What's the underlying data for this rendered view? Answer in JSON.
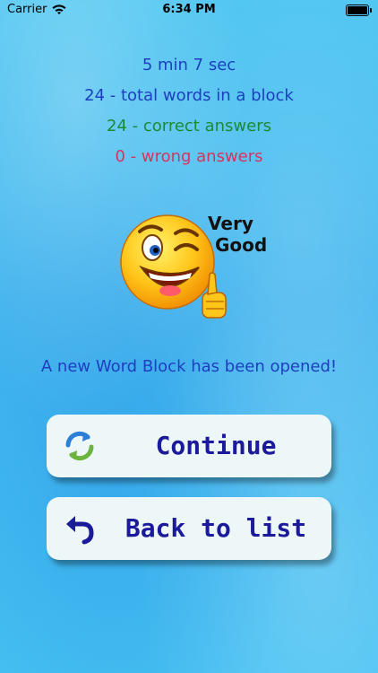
{
  "status": {
    "carrier": "Carrier",
    "time": "6:34 PM"
  },
  "stats": {
    "time": "5 min 7 sec",
    "total": "24 - total words in a block",
    "correct": "24 - correct answers",
    "wrong": "0 - wrong answers"
  },
  "badge": {
    "line1": "Very",
    "line2": "Good"
  },
  "message": "A new Word Block has been opened!",
  "buttons": {
    "continue": "Continue",
    "back": "Back to list"
  },
  "colors": {
    "primary_text": "#1d3fbf",
    "correct_text": "#1c8a34",
    "wrong_text": "#d6345c",
    "button_bg": "#eef7f8",
    "button_text": "#1b1a9a"
  },
  "icons": {
    "continue": "refresh-arrows-icon",
    "back": "back-arrow-icon",
    "emoji": "winking-thumbs-up-emoji"
  }
}
